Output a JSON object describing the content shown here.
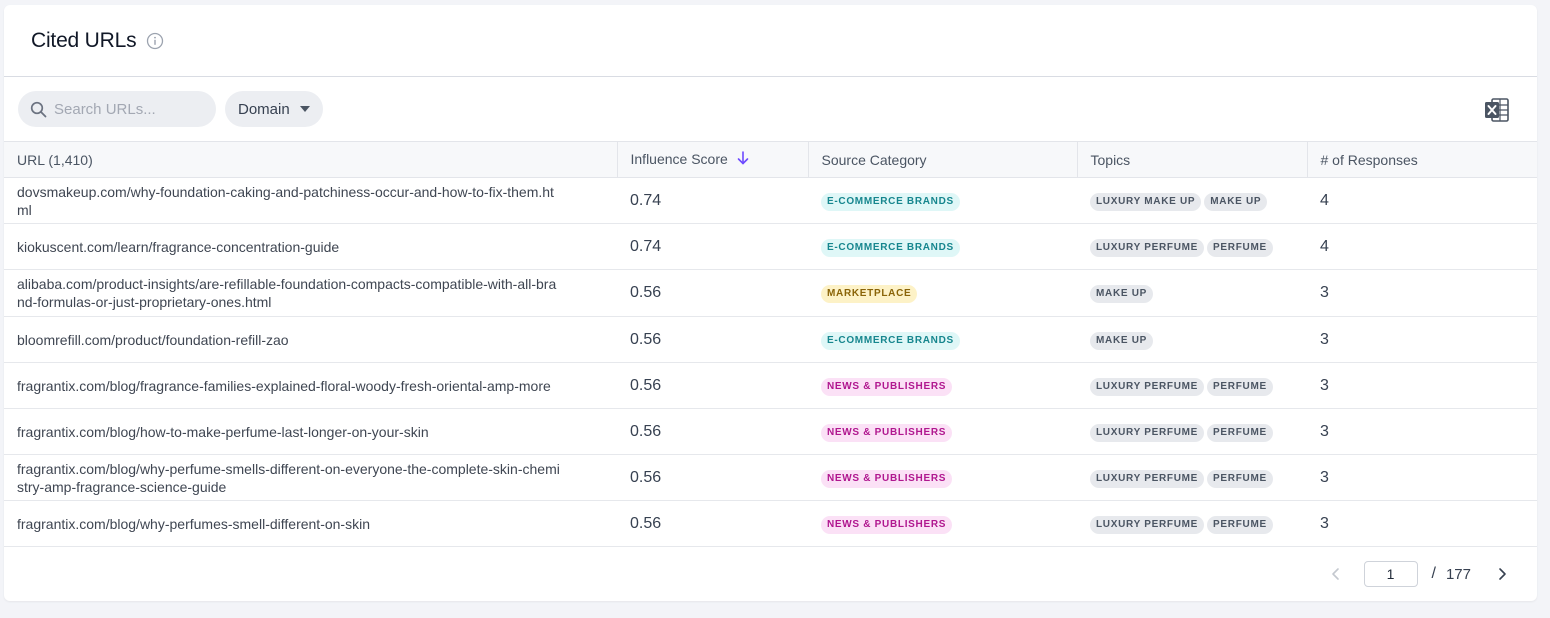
{
  "header": {
    "title": "Cited URLs"
  },
  "toolbar": {
    "search_placeholder": "Search URLs...",
    "domain_label": "Domain"
  },
  "table": {
    "columns": {
      "url": "URL (1,410)",
      "influence": "Influence Score",
      "category": "Source Category",
      "topics": "Topics",
      "responses": "# of Responses"
    },
    "rows": [
      {
        "url": "dovsmakeup.com/why-foundation-caking-and-patchiness-occur-and-how-to-fix-them.html",
        "score": "0.74",
        "category": "E-COMMERCE BRANDS",
        "cat": "ecommerce",
        "topics": [
          "LUXURY MAKE UP",
          "MAKE UP"
        ],
        "responses": "4"
      },
      {
        "url": "kiokuscent.com/learn/fragrance-concentration-guide",
        "score": "0.74",
        "category": "E-COMMERCE BRANDS",
        "cat": "ecommerce",
        "topics": [
          "LUXURY PERFUME",
          "PERFUME"
        ],
        "responses": "4"
      },
      {
        "url": "alibaba.com/product-insights/are-refillable-foundation-compacts-compatible-with-all-brand-formulas-or-just-proprietary-ones.html",
        "score": "0.56",
        "category": "MARKETPLACE",
        "cat": "marketplace",
        "topics": [
          "MAKE UP"
        ],
        "responses": "3"
      },
      {
        "url": "bloomrefill.com/product/foundation-refill-zao",
        "score": "0.56",
        "category": "E-COMMERCE BRANDS",
        "cat": "ecommerce",
        "topics": [
          "MAKE UP"
        ],
        "responses": "3"
      },
      {
        "url": "fragrantix.com/blog/fragrance-families-explained-floral-woody-fresh-oriental-amp-more",
        "score": "0.56",
        "category": "NEWS & PUBLISHERS",
        "cat": "news",
        "topics": [
          "LUXURY PERFUME",
          "PERFUME"
        ],
        "responses": "3"
      },
      {
        "url": "fragrantix.com/blog/how-to-make-perfume-last-longer-on-your-skin",
        "score": "0.56",
        "category": "NEWS & PUBLISHERS",
        "cat": "news",
        "topics": [
          "LUXURY PERFUME",
          "PERFUME"
        ],
        "responses": "3"
      },
      {
        "url": "fragrantix.com/blog/why-perfume-smells-different-on-everyone-the-complete-skin-chemistry-amp-fragrance-science-guide",
        "score": "0.56",
        "category": "NEWS & PUBLISHERS",
        "cat": "news",
        "topics": [
          "LUXURY PERFUME",
          "PERFUME"
        ],
        "responses": "3"
      },
      {
        "url": "fragrantix.com/blog/why-perfumes-smell-different-on-skin",
        "score": "0.56",
        "category": "NEWS & PUBLISHERS",
        "cat": "news",
        "topics": [
          "LUXURY PERFUME",
          "PERFUME"
        ],
        "responses": "3"
      }
    ]
  },
  "pagination": {
    "current": "1",
    "separator": "/",
    "total": "177"
  },
  "colors": {
    "accent": "#6d4aff",
    "ecommerce": "#16868e",
    "marketplace": "#8a6408",
    "news": "#b0178f"
  },
  "icons": {
    "info": "info-icon",
    "search": "search-icon",
    "excel": "excel-export-icon",
    "sort": "sort-desc-arrow-icon",
    "prev": "chevron-left-icon",
    "next": "chevron-right-icon"
  }
}
